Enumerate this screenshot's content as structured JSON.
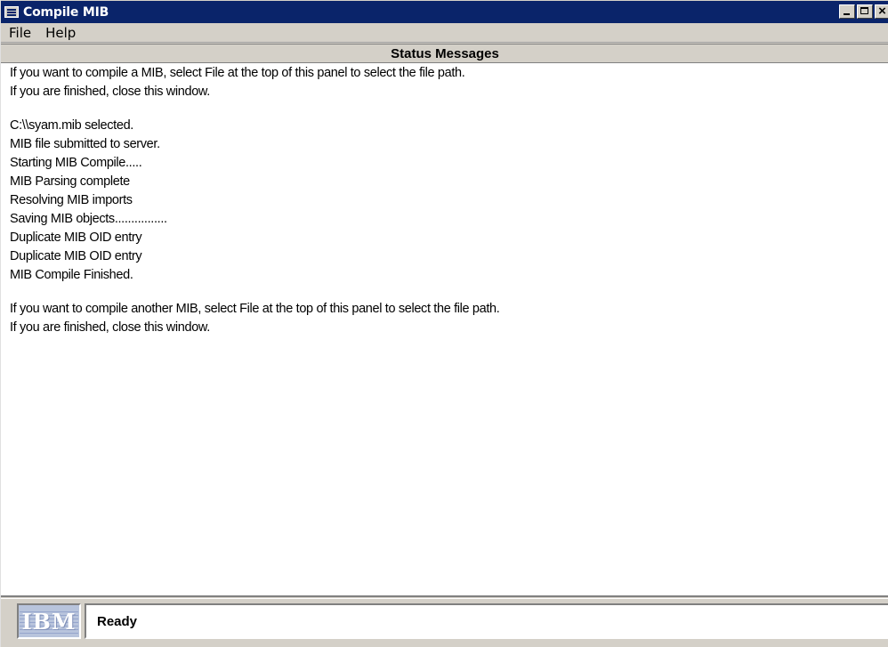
{
  "window": {
    "title": "Compile MIB",
    "controls": {
      "minimize": "",
      "maximize": "",
      "close": "×"
    }
  },
  "menubar": {
    "items": [
      {
        "label": "File"
      },
      {
        "label": "Help"
      }
    ]
  },
  "panel": {
    "header": "Status Messages",
    "messages": [
      "If you want to compile a MIB, select File at the top of this panel to select the file path.",
      "If you are finished, close this window.",
      "",
      "C:\\\\syam.mib selected.",
      "MIB file submitted to server.",
      "Starting MIB Compile.....",
      "MIB Parsing complete",
      "Resolving MIB imports",
      "Saving MIB objects................",
      "Duplicate MIB OID entry",
      "Duplicate MIB OID entry",
      "MIB Compile Finished.",
      "",
      "If you want to compile another MIB, select File at the top of this panel to select the file path.",
      "If you are finished, close this window."
    ]
  },
  "statusbar": {
    "logo": "IBM",
    "status": "Ready"
  },
  "colors": {
    "titlebar": "#0a246a",
    "chrome": "#d4d0c8",
    "content": "#ffffff"
  }
}
